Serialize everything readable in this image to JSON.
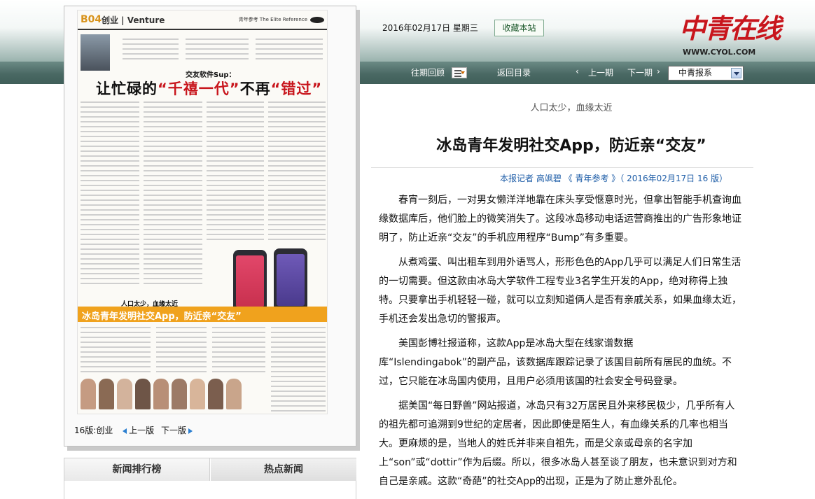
{
  "header": {
    "date": "2016年02月17日  星期三",
    "favorite_label": "收藏本站",
    "logo_text": "中青在线",
    "logo_url": "WWW.CYOL.COM"
  },
  "nav": {
    "past_review": "往期回顾",
    "return_toc": "返回目录",
    "prev_issue": "上一期",
    "next_issue": "下一期",
    "paper_select": "中青报系"
  },
  "paper_preview": {
    "page_no": "B04",
    "section": "创业 | Venture",
    "brand": "青年参考 The Elite Reference",
    "subheading": "交友软件Sup：",
    "headline_pre": "让忙碌的",
    "headline_em": "“千禧一代”",
    "headline_mid": "不再",
    "headline_em2": "“错过”",
    "subheading2": "人口太少，血缘太近",
    "banner": "冰岛青年发明社交App，防近亲“交友”"
  },
  "page_footer": {
    "page_label": "16版:创业",
    "prev_page": "上一版",
    "next_page": "下一版"
  },
  "ranking": {
    "tab1": "新闻排行榜",
    "tab2": "热点新闻"
  },
  "article": {
    "kicker": "人口太少，血缘太近",
    "title": "冰岛青年发明社交App，防近亲“交友”",
    "byline": "本报记者  高飒碧  《  青年参考  》（  2016年02月17日    16  版）",
    "paragraphs": [
      "春宵一刻后，一对男女懒洋洋地靠在床头享受惬意时光，但拿出智能手机查询血缘数据库后，他们脸上的微笑消失了。这段冰岛移动电话运营商推出的广告形象地证明了，防止近亲“交友”的手机应用程序“Bump”有多重要。",
      "从煮鸡蛋、叫出租车到用外语骂人，形形色色的App几乎可以满足人们日常生活的一切需要。但这款由冰岛大学软件工程专业3名学生开发的App，绝对称得上独特。只要拿出手机轻轻一碰，就可以立刻知道俩人是否有亲戚关系，如果血缘太近，手机还会发出急切的警报声。",
      "美国彭博社报道称，这款App是冰岛大型在线家谱数据",
      "库“Islendingabok”的副产品，该数据库跟踪记录了该国目前所有居民的血统。不过，它只能在冰岛国内使用，且用户必须用该国的社会安全号码登录。",
      "据美国“每日野兽”网站报道，冰岛只有32万居民且外来移民极少，几乎所有人的祖先都可追溯到9世纪的定居者，因此即使是陌生人，有血缘关系的几率也相当大。更麻烦的是，当地人的姓氏并非来自祖先，而是父亲或母亲的名字加",
      "上“son”或“dottir”作为后缀。所以，很多冰岛人甚至谈了朋友，也未意识到对方和自己是亲戚。这款“奇葩”的社交App的出现，正是为了防止意外乱伦。"
    ]
  },
  "colors": {
    "nav_bg": "#4a6964",
    "brand_red": "#c8161d",
    "banner_orange": "#f0a21d",
    "link_blue": "#1f5ea8"
  }
}
